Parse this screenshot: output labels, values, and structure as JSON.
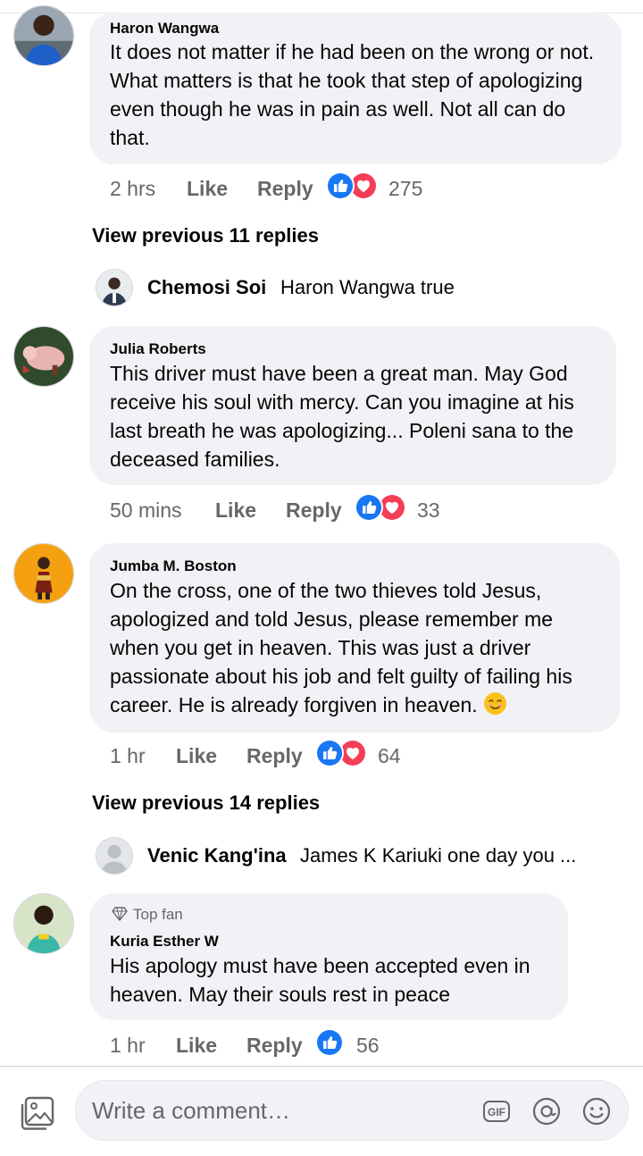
{
  "comments": [
    {
      "author": "Haron Wangwa",
      "text": "It does not matter if he had been on the wrong or not. What matters is that he took that step of apologizing even though he was in pain as well. Not all can do that.",
      "time": "2 hrs",
      "like_label": "Like",
      "reply_label": "Reply",
      "reaction_count": "275",
      "reactions": [
        "like-icon",
        "love-icon"
      ]
    },
    {
      "author": "Julia Roberts",
      "text": "This driver must have been a great man. May God receive his soul with mercy. Can you imagine at his last breath he was apologizing... Poleni sana to the deceased families.",
      "time": "50 mins",
      "like_label": "Like",
      "reply_label": "Reply",
      "reaction_count": "33",
      "reactions": [
        "like-icon",
        "love-icon"
      ]
    },
    {
      "author": "Jumba M. Boston",
      "text": "On the cross, one of the two thieves told Jesus, apologized and told Jesus, please remember me when you get in heaven. This was just a driver passionate about his job and felt guilty of failing his career. He is already forgiven in heaven.",
      "emoji": "smiling-face-emoji",
      "time": "1 hr",
      "like_label": "Like",
      "reply_label": "Reply",
      "reaction_count": "64",
      "reactions": [
        "like-icon",
        "love-icon"
      ]
    },
    {
      "badge": "Top fan",
      "author": "Kuria Esther W",
      "text": "His apology must have been accepted even in heaven. May their souls rest in peace",
      "time": "1 hr",
      "like_label": "Like",
      "reply_label": "Reply",
      "reaction_count": "56",
      "reactions": [
        "like-icon"
      ]
    }
  ],
  "view_previous": [
    "View previous 11 replies",
    "View previous 14 replies"
  ],
  "reply_previews": [
    {
      "author": "Chemosi Soi",
      "text": "Haron Wangwa true"
    },
    {
      "author": "Venic Kang'ina",
      "text": "James K Kariuki one day you ..."
    }
  ],
  "composer": {
    "placeholder": "Write a comment…",
    "icons": [
      "gallery-icon",
      "gif-icon",
      "mention-icon",
      "emoji-icon"
    ]
  },
  "colors": {
    "like_blue": "#1877f2",
    "love_red": "#f33e58",
    "bubble_bg": "#f0f2f5",
    "meta_gray": "#65676b"
  }
}
